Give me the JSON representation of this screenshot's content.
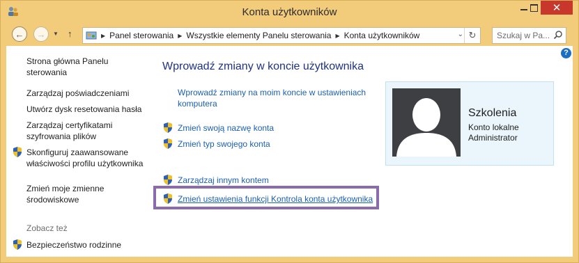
{
  "window": {
    "title": "Konta użytkowników",
    "close_glyph": "✕"
  },
  "nav": {
    "back_icon": "arrow-left-icon",
    "forward_icon": "arrow-right-icon",
    "up_icon": "arrow-up-icon",
    "breadcrumbs": [
      "Panel sterowania",
      "Wszystkie elementy Panelu sterowania",
      "Konta użytkowników"
    ],
    "search_placeholder": "Szukaj w Pa..."
  },
  "sidebar": {
    "items": [
      {
        "label": "Strona główna Panelu sterowania",
        "shield": false
      },
      {
        "label": "Zarządzaj poświadczeniami",
        "shield": false
      },
      {
        "label": "Utwórz dysk resetowania hasła",
        "shield": false
      },
      {
        "label": "Zarządzaj certyfikatami szyfrowania plików",
        "shield": false
      },
      {
        "label": "Skonfiguruj zaawansowane właściwości profilu użytkownika",
        "shield": true
      },
      {
        "label": "Zmień moje zmienne środowiskowe",
        "shield": false
      }
    ],
    "see_also_heading": "Zobacz też",
    "see_also_items": [
      {
        "label": "Bezpieczeństwo rodzinne",
        "shield": true
      }
    ]
  },
  "main": {
    "title": "Wprowadź zmiany w koncie użytkownika",
    "pc_settings_link": "Wprowadź zmiany na moim koncie w ustawieniach komputera",
    "links": [
      {
        "label": "Zmień swoją nazwę konta",
        "shield": true
      },
      {
        "label": "Zmień typ swojego konta",
        "shield": true
      },
      {
        "label": "Zarządzaj innym kontem",
        "shield": true
      },
      {
        "label": "Zmień ustawienia funkcji Kontrola konta użytkownika",
        "shield": true,
        "highlighted": true
      }
    ]
  },
  "account": {
    "name": "Szkolenia",
    "type": "Konto lokalne",
    "role": "Administrator"
  },
  "colors": {
    "title_bar": "#f2cb7b",
    "link": "#1a5fb4",
    "heading": "#1e3287",
    "highlight_border": "#8a6bab",
    "close_button": "#c7372b"
  }
}
